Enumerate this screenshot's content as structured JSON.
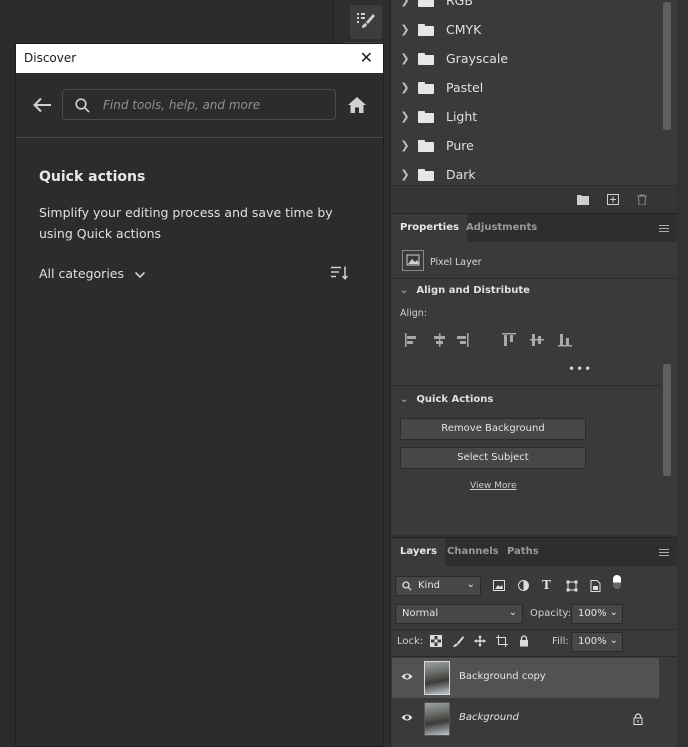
{
  "discover": {
    "title": "Discover",
    "search_placeholder": "Find tools, help, and more",
    "quick_actions_heading": "Quick actions",
    "quick_actions_description": "Simplify your editing process and save time by using Quick actions",
    "category_filter": "All categories"
  },
  "swatches": {
    "groups": [
      {
        "label": "RGB"
      },
      {
        "label": "CMYK"
      },
      {
        "label": "Grayscale"
      },
      {
        "label": "Pastel"
      },
      {
        "label": "Light"
      },
      {
        "label": "Pure"
      },
      {
        "label": "Dark"
      }
    ]
  },
  "properties": {
    "tabs": [
      "Properties",
      "Adjustments"
    ],
    "layer_type": "Pixel Layer",
    "align_section": "Align and Distribute",
    "align_label": "Align:",
    "quick_actions_section": "Quick Actions",
    "remove_bg_button": "Remove Background",
    "select_subject_button": "Select Subject",
    "view_more": "View More"
  },
  "layers": {
    "tabs": [
      "Layers",
      "Channels",
      "Paths"
    ],
    "filter_kind": "Kind",
    "blend_mode": "Normal",
    "opacity_label": "Opacity:",
    "opacity_value": "100%",
    "lock_label": "Lock:",
    "fill_label": "Fill:",
    "fill_value": "100%",
    "items": [
      {
        "name": "Background copy",
        "selected": true
      },
      {
        "name": "Background",
        "selected": false,
        "locked": true
      }
    ]
  },
  "colors": {
    "panel_bg": "#3a3a3a",
    "dialog_bg": "#2c2c2c",
    "selected_row": "#525252"
  }
}
